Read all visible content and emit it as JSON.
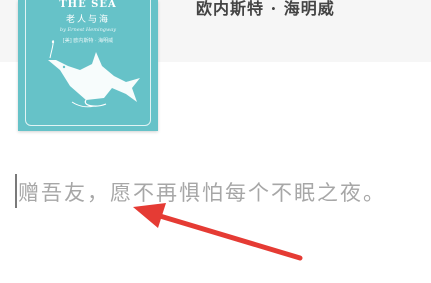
{
  "book": {
    "cover": {
      "title_en": "THE SEA",
      "title_zh": "老人与海",
      "author_en": "by Ernest Hemingway",
      "author_zh": "[美] 欧内斯特 · 海明威",
      "background_color": "#66c2c8"
    },
    "author": "欧内斯特 · 海明威"
  },
  "dedication": {
    "text": "赠吾友，愿不再惧怕每个不眠之夜。"
  },
  "annotation": {
    "arrow_color": "#e53b34"
  }
}
